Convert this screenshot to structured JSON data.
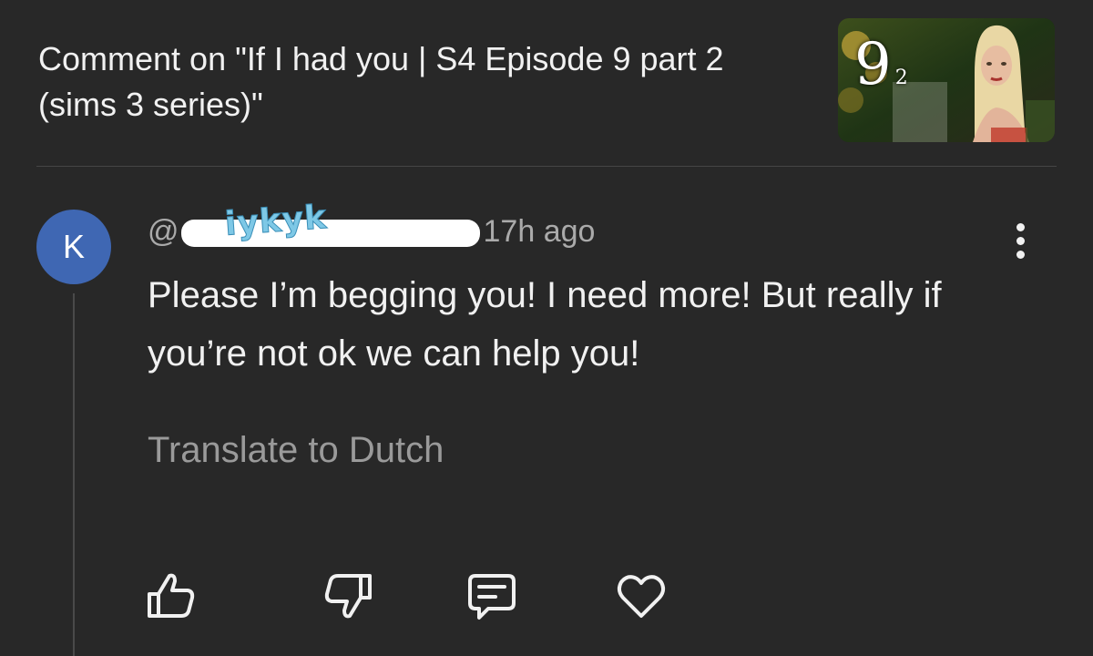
{
  "header": {
    "title": "Comment on \"If I had you | S4 Episode 9 part 2 (sims 3 series)\"",
    "thumbnail": {
      "number": "9",
      "subscript": "2"
    }
  },
  "comment": {
    "avatar_letter": "K",
    "handle_prefix": "@",
    "redaction_scribble": "iykyk",
    "timestamp": "17h ago",
    "text": "Please I’m begging you! I need more! But really if you’re not ok we can help you!",
    "translate_label": "Translate to Dutch"
  },
  "actions": [
    {
      "name": "like-button",
      "icon": "thumbs-up-icon"
    },
    {
      "name": "dislike-button",
      "icon": "thumbs-down-icon"
    },
    {
      "name": "reply-button",
      "icon": "comment-icon"
    },
    {
      "name": "heart-button",
      "icon": "heart-icon"
    }
  ],
  "colors": {
    "background": "#282828",
    "text": "#f1f1f1",
    "secondary_text": "#aaaaaa",
    "avatar": "#3f67b3"
  }
}
